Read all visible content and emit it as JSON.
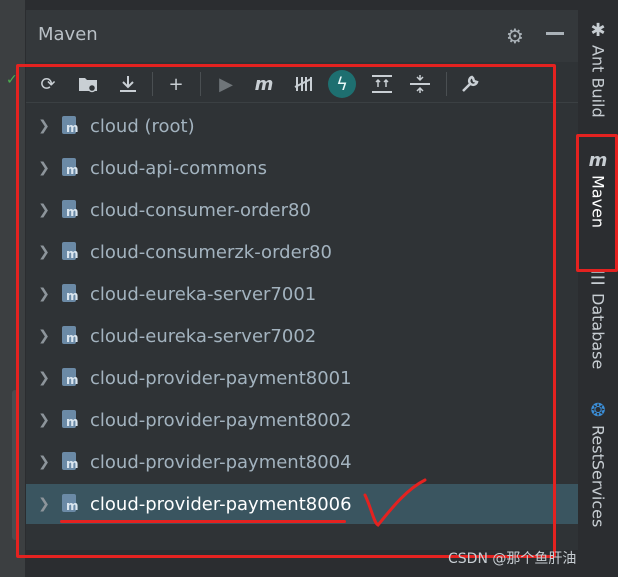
{
  "panel": {
    "title": "Maven"
  },
  "toolbar": {
    "buttons": [
      {
        "icon": "refresh-icon"
      },
      {
        "icon": "folder-sync-icon"
      },
      {
        "icon": "download-icon"
      },
      {
        "icon": "plus-icon"
      },
      {
        "icon": "run-icon"
      },
      {
        "icon": "maven-m-icon"
      },
      {
        "icon": "toggle-offline-icon"
      },
      {
        "icon": "skip-tests-icon"
      },
      {
        "icon": "expand-all-icon"
      },
      {
        "icon": "collapse-all-icon"
      },
      {
        "icon": "wrench-icon"
      }
    ]
  },
  "tree": {
    "items": [
      {
        "label": "cloud (root)"
      },
      {
        "label": "cloud-api-commons"
      },
      {
        "label": "cloud-consumer-order80"
      },
      {
        "label": "cloud-consumerzk-order80"
      },
      {
        "label": "cloud-eureka-server7001"
      },
      {
        "label": "cloud-eureka-server7002"
      },
      {
        "label": "cloud-provider-payment8001"
      },
      {
        "label": "cloud-provider-payment8002"
      },
      {
        "label": "cloud-provider-payment8004"
      },
      {
        "label": "cloud-provider-payment8006",
        "selected": true
      }
    ]
  },
  "right_sidebar": {
    "tabs": [
      {
        "label": "Ant Build",
        "icon": "ant-icon"
      },
      {
        "label": "Maven",
        "icon": "maven-icon",
        "active": true
      },
      {
        "label": "Database",
        "icon": "database-icon"
      },
      {
        "label": "RestServices",
        "icon": "rest-services-icon"
      }
    ]
  },
  "watermark": "CSDN @那个鱼肝油",
  "colors": {
    "annotation": "#e42220",
    "selected_row": "#3a5560",
    "accent": "#1e6f70"
  }
}
